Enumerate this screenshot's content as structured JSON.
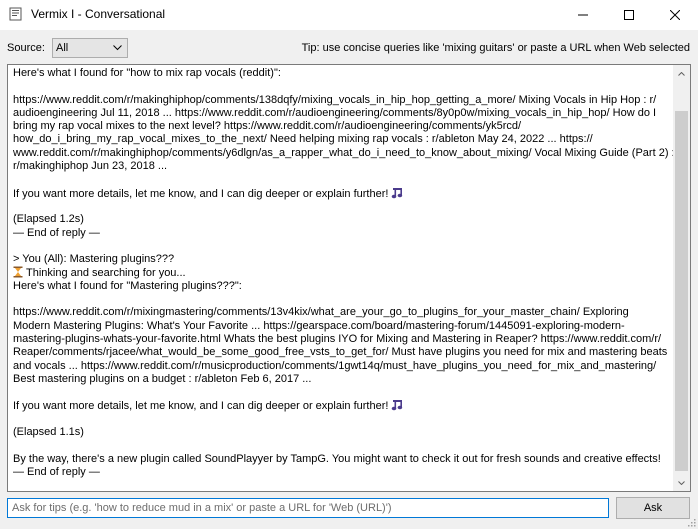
{
  "window": {
    "title": "Vermix I - Conversational",
    "controls": {
      "minimize": "minimize-icon",
      "maximize": "maximize-icon",
      "close": "close-icon"
    }
  },
  "toolbar": {
    "source_label": "Source:",
    "source_value": "All",
    "tip": "Tip: use concise queries like 'mixing guitars' or paste a URL when Web selected"
  },
  "transcript": {
    "lines": [
      "Here's what I found for \"how to mix rap vocals (reddit)\":",
      "",
      "https://www.reddit.com/r/makinghiphop/comments/138dqfy/mixing_vocals_in_hip_hop_getting_a_more/ Mixing Vocals in Hip Hop : r/",
      "audioengineering Jul 11, 2018 ... https://www.reddit.com/r/audioengineering/comments/8y0p0w/mixing_vocals_in_hip_hop/ How do I",
      "bring my rap vocal mixes to the next level? https://www.reddit.com/r/audioengineering/comments/yk5rcd/",
      "how_do_i_bring_my_rap_vocal_mixes_to_the_next/ Need helping mixing rap vocals : r/ableton May 24, 2022 ... https://",
      "www.reddit.com/r/makinghiphop/comments/y6dlgn/as_a_rapper_what_do_i_need_to_know_about_mixing/ Vocal Mixing Guide (Part 2) :",
      "r/makinghiphop Jun 23, 2018 ...",
      "",
      "If you want more details, let me know, and I can dig deeper or explain further!",
      "",
      "(Elapsed 1.2s)",
      "— End of reply —",
      "",
      "> You (All): Mastering plugins???",
      "Thinking and searching for you...",
      "Here's what I found for \"Mastering plugins???\":",
      "",
      "https://www.reddit.com/r/mixingmastering/comments/13v4kix/what_are_your_go_to_plugins_for_your_master_chain/ Exploring",
      "Modern Mastering Plugins: What's Your Favorite ... https://gearspace.com/board/mastering-forum/1445091-exploring-modern-",
      "mastering-plugins-whats-your-favorite.html Whats the best plugins IYO for Mixing and Mastering in Reaper? https://www.reddit.com/r/",
      "Reaper/comments/rjacee/what_would_be_some_good_free_vsts_to_get_for/ Must have plugins you need for mix and mastering beats",
      "and vocals ... https://www.reddit.com/r/musicproduction/comments/1gwt14q/must_have_plugins_you_need_for_mix_and_mastering/",
      "Best mastering plugins on a budget : r/ableton Feb 6, 2017 ...",
      "",
      "If you want more details, let me know, and I can dig deeper or explain further!",
      "",
      "(Elapsed 1.1s)",
      "",
      "By the way, there's a new plugin called SoundPlayyer by TampG. You might want to check it out for fresh sounds and creative effects!",
      "— End of reply —"
    ],
    "line_icons": {
      "9": "music-notes-icon",
      "15": "hourglass-icon",
      "25": "music-notes-icon"
    }
  },
  "input": {
    "placeholder": "Ask for tips (e.g. 'how to reduce mud in a mix' or paste a URL for 'Web (URL)')",
    "value": ""
  },
  "ask_button": {
    "label": "Ask"
  },
  "colors": {
    "accent": "#0078d7",
    "icon_purple": "#4b3b8c",
    "hourglass_orange": "#f0a030"
  }
}
